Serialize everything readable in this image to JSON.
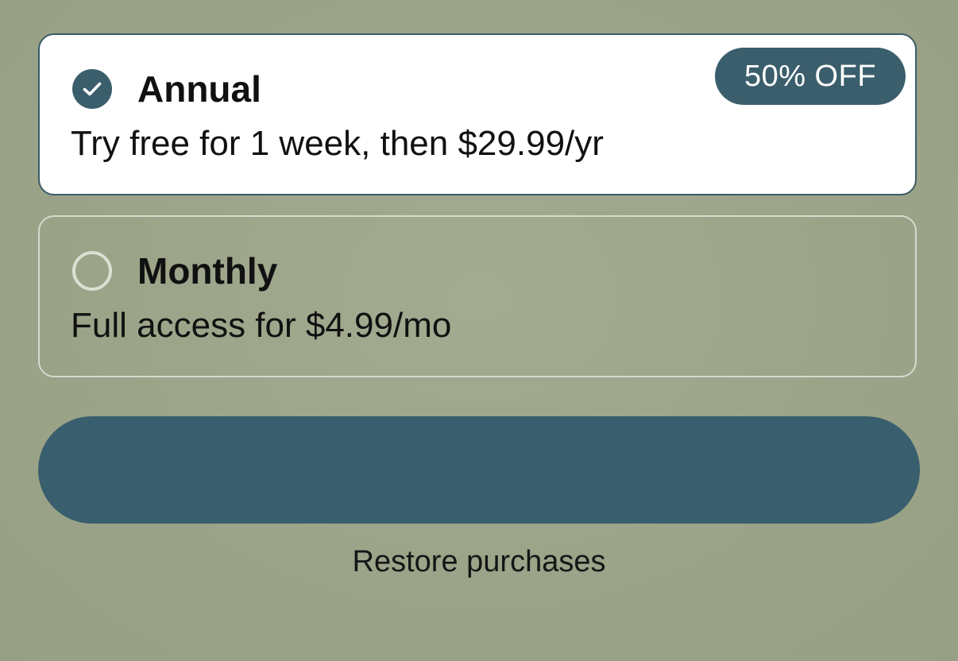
{
  "plans": [
    {
      "title": "Annual",
      "description": "Try free for 1 week, then $29.99/yr",
      "badge": "50% OFF",
      "selected": true
    },
    {
      "title": "Monthly",
      "description": "Full access for $4.99/mo",
      "selected": false
    }
  ],
  "cta": {
    "label": ""
  },
  "footer": {
    "restore_label": "Restore purchases"
  },
  "colors": {
    "background": "#9ba388",
    "accent": "#3b5e6c",
    "selected_card": "#ffffff",
    "unselected_border": "#d6d9cc"
  },
  "icons": {
    "selected_radio": "check-circle-icon",
    "unselected_radio": "empty-circle-icon"
  }
}
